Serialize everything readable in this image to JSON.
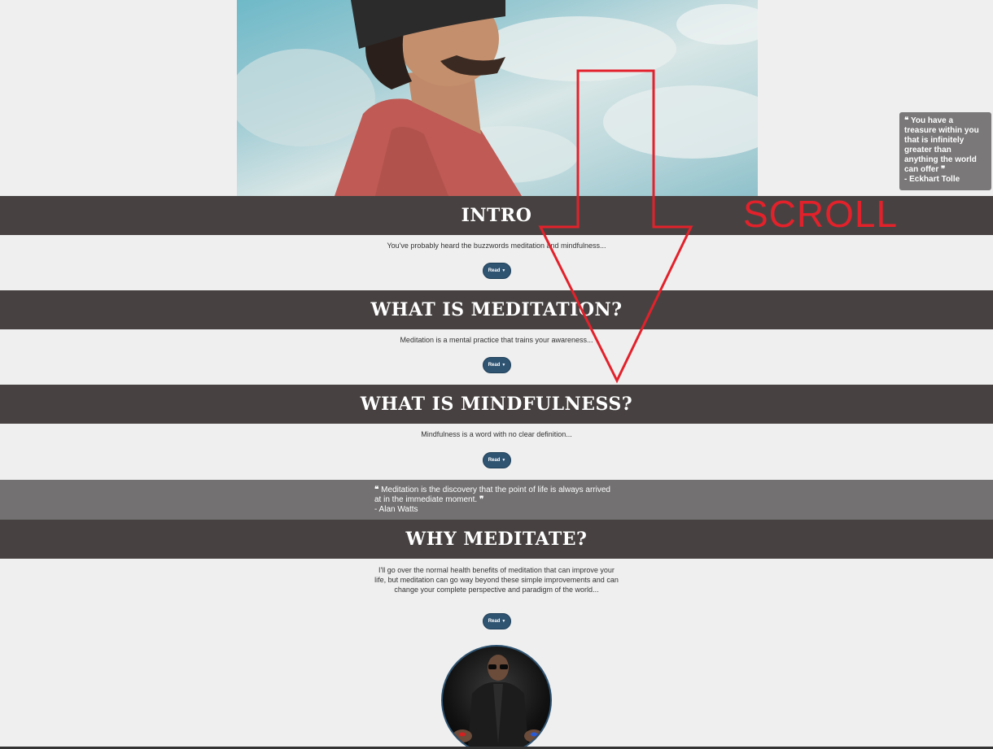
{
  "hero": {
    "image_alt": "man-looking-up-sky"
  },
  "sections": [
    {
      "title": "INTRO",
      "text": "You've probably heard the buzzwords meditation and mindfulness...",
      "read_label": "Read"
    },
    {
      "title": "WHAT IS MEDITATION?",
      "text": "Meditation is a mental practice that trains your awareness...",
      "read_label": "Read"
    },
    {
      "title": "WHAT IS MINDFULNESS?",
      "text": "Mindfulness is a word with no clear definition...",
      "read_label": "Read"
    },
    {
      "title": "WHY MEDITATE?",
      "text": "I'll go over the normal health benefits of meditation that can improve your life, but meditation can go way beyond these simple improvements and can change your complete perspective and paradigm of the world...",
      "read_label": "Read"
    }
  ],
  "quote_band": {
    "open_mark": "❝",
    "close_mark": "❞",
    "text": "Meditation is the discovery that the point of life is always arrived at in the immediate moment.",
    "author": "- Alan Watts"
  },
  "side_quote": {
    "open_mark": "❝",
    "close_mark": "❞",
    "text": "You have a treasure within you that is infinitely greater than anything the world can offer",
    "author": "- Eckhart Tolle"
  },
  "annotation": {
    "label": "SCROLL",
    "color": "#e3212b"
  },
  "colors": {
    "band": "#474241",
    "button": "#2f5472",
    "quote_band": "#737171",
    "background": "#efefef"
  }
}
